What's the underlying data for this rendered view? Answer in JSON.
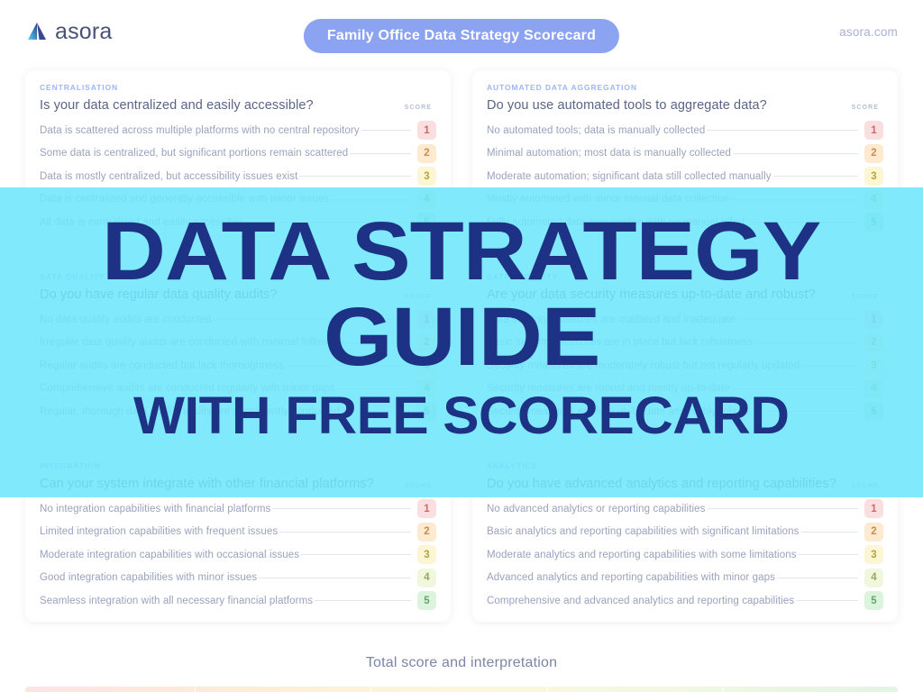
{
  "header": {
    "brand_name": "asora",
    "title_pill": "Family Office Data Strategy Scorecard",
    "site_url": "asora.com",
    "logo_icon": "asora-triangle-logo",
    "brand_accent": "#8ba3f0"
  },
  "score_header_label": "SCORE",
  "cards": [
    {
      "eyebrow": "CENTRALISATION",
      "question": "Is your data centralized and easily accessible?",
      "options": [
        {
          "text": "Data is scattered across multiple platforms with no central repository",
          "score": "1"
        },
        {
          "text": "Some data is centralized, but significant portions remain scattered",
          "score": "2"
        },
        {
          "text": "Data is mostly centralized, but accessibility issues exist",
          "score": "3"
        },
        {
          "text": "Data is centralized and generally accessible with minor issues",
          "score": "4"
        },
        {
          "text": "All data is centralized and easily accessible",
          "score": "5"
        }
      ]
    },
    {
      "eyebrow": "AUTOMATED DATA AGGREGATION",
      "question": "Do you use automated tools to aggregate data?",
      "options": [
        {
          "text": "No automated tools; data is manually collected",
          "score": "1"
        },
        {
          "text": "Minimal automation; most data is manually collected",
          "score": "2"
        },
        {
          "text": "Moderate automation; significant data still collected manually",
          "score": "3"
        },
        {
          "text": "Mostly automated with minor manual data collection",
          "score": "4"
        },
        {
          "text": "Fully automated data aggregation with no manual effort",
          "score": "5"
        }
      ]
    },
    {
      "eyebrow": "DATA QUALITY",
      "question": "Do you have regular data quality audits?",
      "options": [
        {
          "text": "No data quality audits are conducted",
          "score": "1"
        },
        {
          "text": "Irregular data quality audits are conducted with minimal follow-up",
          "score": "2"
        },
        {
          "text": "Regular audits are conducted but lack thoroughness",
          "score": "3"
        },
        {
          "text": "Comprehensive audits are conducted regularly with minor gaps",
          "score": "4"
        },
        {
          "text": "Regular, thorough data quality audits are consistently conducted",
          "score": "5"
        }
      ]
    },
    {
      "eyebrow": "DATA SECURITY",
      "question": "Are your data security measures up-to-date and robust?",
      "options": [
        {
          "text": "Data security measures are outdated and inadequate",
          "score": "1"
        },
        {
          "text": "Basic security measures are in place but lack robustness",
          "score": "2"
        },
        {
          "text": "Security measures are moderately robust but not regularly updated",
          "score": "3"
        },
        {
          "text": "Security measures are robust and mostly up-to-date",
          "score": "4"
        },
        {
          "text": "Security measures are fully up-to-date and highly robust",
          "score": "5"
        }
      ]
    },
    {
      "eyebrow": "INTEGRATION",
      "question": "Can your system integrate with other financial platforms?",
      "options": [
        {
          "text": "No integration capabilities with financial platforms",
          "score": "1"
        },
        {
          "text": "Limited integration capabilities with frequent issues",
          "score": "2"
        },
        {
          "text": "Moderate integration capabilities with occasional issues",
          "score": "3"
        },
        {
          "text": "Good integration capabilities with minor issues",
          "score": "4"
        },
        {
          "text": "Seamless integration with all necessary financial platforms",
          "score": "5"
        }
      ]
    },
    {
      "eyebrow": "ANALYTICS",
      "question": "Do you have advanced analytics and reporting capabilities?",
      "options": [
        {
          "text": "No advanced analytics or reporting capabilities",
          "score": "1"
        },
        {
          "text": "Basic analytics and reporting capabilities with significant limitations",
          "score": "2"
        },
        {
          "text": "Moderate analytics and reporting capabilities with some limitations",
          "score": "3"
        },
        {
          "text": "Advanced analytics and reporting capabilities with minor gaps",
          "score": "4"
        },
        {
          "text": "Comprehensive and advanced analytics and reporting capabilities",
          "score": "5"
        }
      ]
    }
  ],
  "footer": {
    "total_score_title": "Total score and interpretation"
  },
  "promo_overlay": {
    "line1": "DATA STRATEGY",
    "line2": "GUIDE",
    "line3": "WITH FREE SCORECARD",
    "band_color": "#6ee6fa",
    "text_color": "#1d3284"
  }
}
